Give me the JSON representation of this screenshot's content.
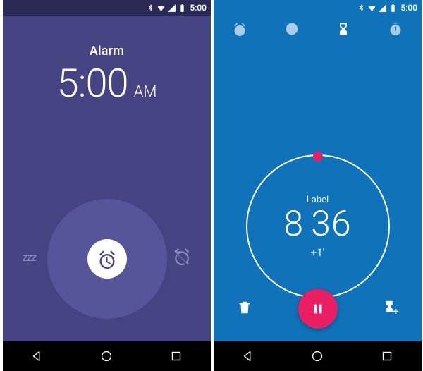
{
  "status_time": "5:00",
  "left_screen": {
    "title": "Alarm",
    "time": "5:00",
    "ampm": "AM",
    "snooze_label": "zzz"
  },
  "right_screen": {
    "tabs": [
      "alarm",
      "clock",
      "timer",
      "stopwatch"
    ],
    "active_tab": "timer",
    "timer": {
      "label": "Label",
      "minutes": "8",
      "seconds": "36",
      "plus_one": "+1'"
    }
  },
  "colors": {
    "left_bg": "#454381",
    "left_status": "#2B2A55",
    "right_bg": "#1072B9",
    "accent_pink": "#E91E63",
    "muted_purple": "#8E8CC0"
  }
}
